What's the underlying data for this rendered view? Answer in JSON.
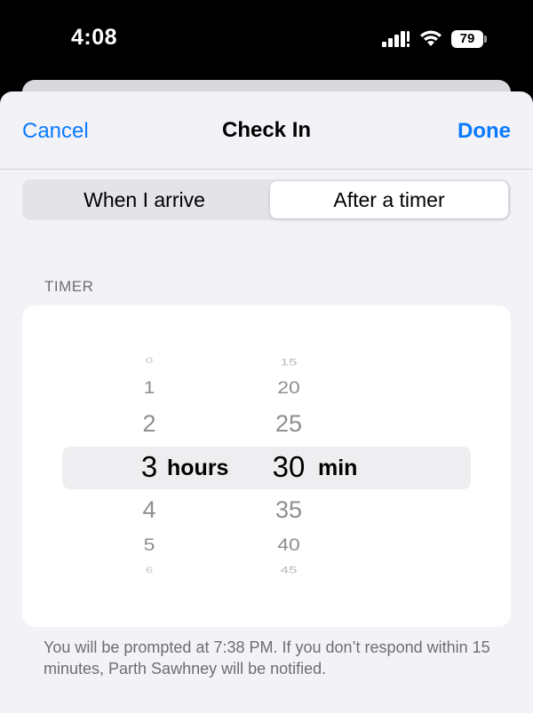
{
  "status_bar": {
    "time": "4:08",
    "battery": "79",
    "icons": [
      "signal-icon",
      "wifi-icon",
      "battery-icon"
    ]
  },
  "nav": {
    "cancel_label": "Cancel",
    "title": "Check In",
    "done_label": "Done",
    "accent_color": "#0a7aff"
  },
  "segmented": {
    "options": [
      "When I arrive",
      "After a timer"
    ],
    "selected": "After a timer"
  },
  "timer": {
    "section_label": "TIMER",
    "hours_values": [
      "0",
      "1",
      "2",
      "3",
      "4",
      "5",
      "6"
    ],
    "hours_selected": "3",
    "hours_unit": "hours",
    "minutes_values": [
      "15",
      "20",
      "25",
      "30",
      "35",
      "40",
      "45"
    ],
    "minutes_selected": "30",
    "minutes_unit": "min"
  },
  "footer": {
    "note": "You will be prompted at 7:38 PM. If you don’t respond within 15 minutes, Parth Sawhney will be notified."
  }
}
